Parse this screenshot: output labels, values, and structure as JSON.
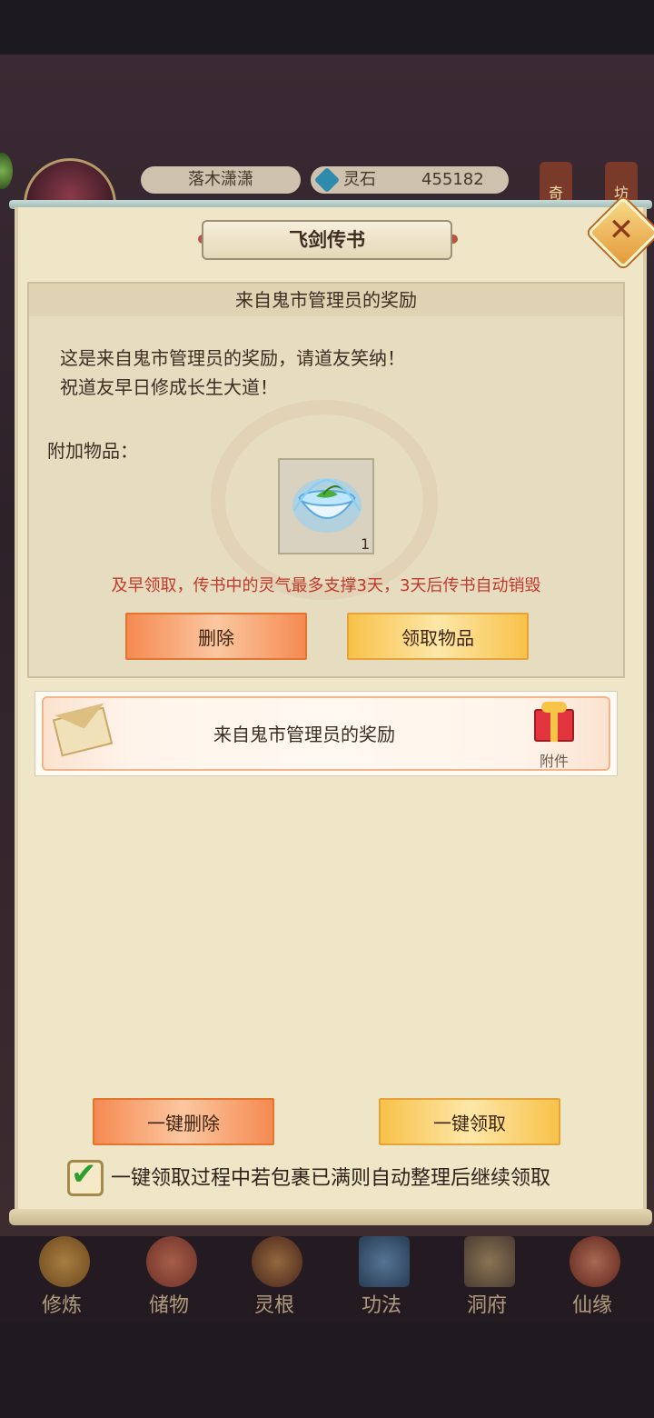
{
  "top_status": {
    "player_name": "落木潇潇",
    "stone_label": "灵石",
    "stone_value": "455182",
    "right_buttons": [
      "奇",
      "坊"
    ]
  },
  "dialog": {
    "title": "飞剑传书",
    "mail": {
      "subject": "来自鬼市管理员的奖励",
      "body_lines": [
        "这是来自鬼市管理员的奖励，请道友笑纳！",
        "祝道友早日修成长生大道！"
      ],
      "attachment_label": "附加物品：",
      "attachment_item": {
        "icon": "spirit-tea-bowl-icon",
        "count": "1"
      },
      "warning": "及早领取，传书中的灵气最多支撑3天，3天后传书自动销毁",
      "delete_label": "删除",
      "claim_label": "领取物品"
    },
    "mail_list": [
      {
        "title": "来自鬼市管理员的奖励",
        "tag": "附件",
        "icon": "envelope-icon"
      }
    ],
    "delete_all_label": "一键删除",
    "claim_all_label": "一键领取",
    "auto_sort": {
      "checked": true,
      "text": "一键领取过程中若包裹已满则自动整理后继续领取"
    }
  },
  "bottom_nav": [
    {
      "label": "修炼",
      "icon": "cultivation-icon",
      "color": "#b8782a"
    },
    {
      "label": "储物",
      "icon": "storage-bag-icon",
      "color": "#c25a3a"
    },
    {
      "label": "灵根",
      "icon": "spirit-root-icon",
      "color": "#8a4a2a"
    },
    {
      "label": "功法",
      "icon": "scripture-book-icon",
      "color": "#3a6a9a"
    },
    {
      "label": "洞府",
      "icon": "cave-palace-icon",
      "color": "#8a6a4a"
    },
    {
      "label": "仙缘",
      "icon": "immortal-fate-icon",
      "color": "#b84a3a"
    }
  ],
  "colors": {
    "warning": "#c0392b",
    "orange_button": "#f58a52",
    "yellow_button": "#f8c24a"
  }
}
